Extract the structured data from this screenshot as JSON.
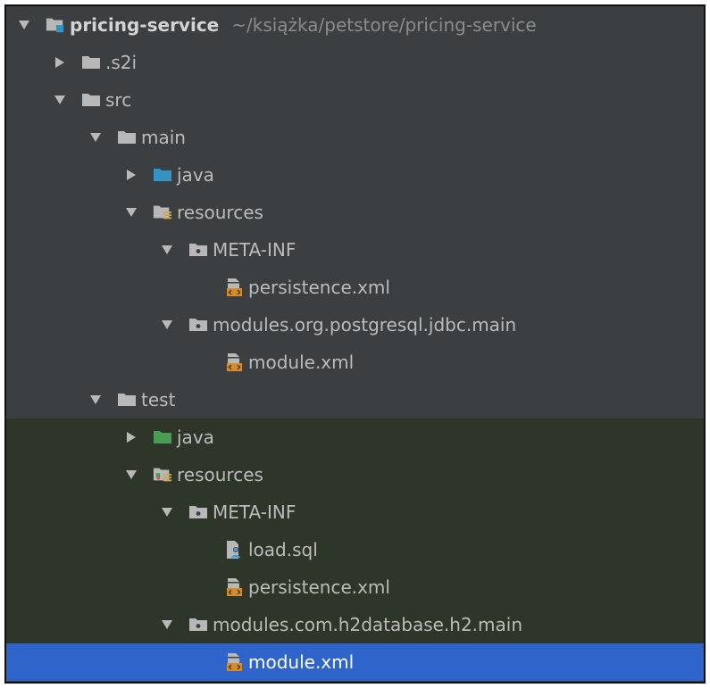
{
  "project_tree": {
    "root": {
      "label": "pricing-service",
      "path": "~/książka/petstore/pricing-service"
    },
    "nodes": [
      {
        "name": "node-s2i",
        "label": ".s2i",
        "depth": 1,
        "arrow": "collapsed",
        "icon": "folder-icon",
        "zone": "main"
      },
      {
        "name": "node-src",
        "label": "src",
        "depth": 1,
        "arrow": "expanded",
        "icon": "folder-icon",
        "zone": "main"
      },
      {
        "name": "node-main",
        "label": "main",
        "depth": 2,
        "arrow": "expanded",
        "icon": "folder-icon",
        "zone": "main"
      },
      {
        "name": "node-main-java",
        "label": "java",
        "depth": 3,
        "arrow": "collapsed",
        "icon": "source-folder-icon",
        "zone": "main"
      },
      {
        "name": "node-main-resources",
        "label": "resources",
        "depth": 3,
        "arrow": "expanded",
        "icon": "resources-folder-icon",
        "zone": "main"
      },
      {
        "name": "node-main-meta-inf",
        "label": "META-INF",
        "depth": 4,
        "arrow": "expanded",
        "icon": "package-folder-icon",
        "zone": "main"
      },
      {
        "name": "node-main-persistence-xml",
        "label": "persistence.xml",
        "depth": 5,
        "arrow": "none",
        "icon": "xml-file-icon",
        "zone": "main"
      },
      {
        "name": "node-main-modules-postgresql",
        "label": "modules.org.postgresql.jdbc.main",
        "depth": 4,
        "arrow": "expanded",
        "icon": "package-folder-icon",
        "zone": "main"
      },
      {
        "name": "node-main-module-xml",
        "label": "module.xml",
        "depth": 5,
        "arrow": "none",
        "icon": "xml-file-icon",
        "zone": "main"
      },
      {
        "name": "node-test",
        "label": "test",
        "depth": 2,
        "arrow": "expanded",
        "icon": "folder-icon",
        "zone": "main"
      },
      {
        "name": "node-test-java",
        "label": "java",
        "depth": 3,
        "arrow": "collapsed",
        "icon": "test-source-folder-icon",
        "zone": "test"
      },
      {
        "name": "node-test-resources",
        "label": "resources",
        "depth": 3,
        "arrow": "expanded",
        "icon": "test-resources-folder-icon",
        "zone": "test"
      },
      {
        "name": "node-test-meta-inf",
        "label": "META-INF",
        "depth": 4,
        "arrow": "expanded",
        "icon": "package-folder-icon",
        "zone": "test"
      },
      {
        "name": "node-test-load-sql",
        "label": "load.sql",
        "depth": 5,
        "arrow": "none",
        "icon": "sql-file-icon",
        "zone": "test"
      },
      {
        "name": "node-test-persistence-xml",
        "label": "persistence.xml",
        "depth": 5,
        "arrow": "none",
        "icon": "xml-file-icon",
        "zone": "test"
      },
      {
        "name": "node-test-modules-h2",
        "label": "modules.com.h2database.h2.main",
        "depth": 4,
        "arrow": "expanded",
        "icon": "package-folder-icon",
        "zone": "test"
      },
      {
        "name": "node-test-module-xml",
        "label": "module.xml",
        "depth": 5,
        "arrow": "none",
        "icon": "xml-file-icon",
        "zone": "selected"
      }
    ]
  },
  "colors": {
    "panel_bg": "#3c3f41",
    "test_bg": "#2e3629",
    "selection_bg": "#2f65ca",
    "folder": "#b8b8b8",
    "source_folder": "#3592c4",
    "test_folder": "#499c54",
    "resource_marker": "#d0a84a",
    "xml_orange": "#d98b27"
  }
}
